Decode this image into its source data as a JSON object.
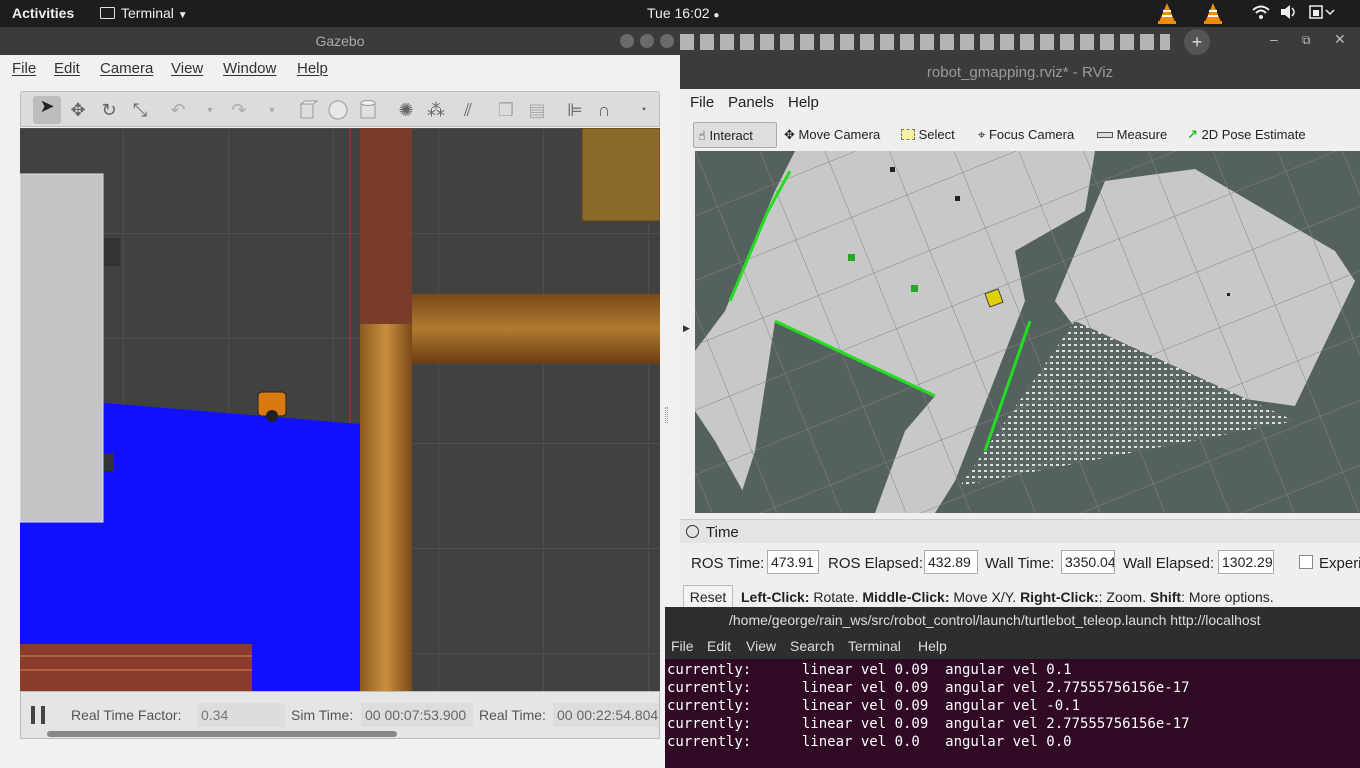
{
  "topbar": {
    "activities": "Activities",
    "app_name": "Terminal",
    "clock": "Tue 16:02"
  },
  "gazebo": {
    "title": "Gazebo",
    "menu": [
      "File",
      "Edit",
      "Camera",
      "View",
      "Window",
      "Help"
    ],
    "status": {
      "rtf_label": "Real Time Factor:",
      "rtf_value": "0.34",
      "sim_label": "Sim Time:",
      "sim_value": "00 00:07:53.900",
      "real_label": "Real Time:",
      "real_value": "00 00:22:54.804"
    }
  },
  "rviz": {
    "title": "robot_gmapping.rviz* - RViz",
    "menu": [
      "File",
      "Panels",
      "Help"
    ],
    "tools": [
      "Interact",
      "Move Camera",
      "Select",
      "Focus Camera",
      "Measure",
      "2D Pose Estimate"
    ],
    "time_panel": {
      "title": "Time",
      "ros_time_label": "ROS Time:",
      "ros_time_value": "473.91",
      "ros_elapsed_label": "ROS Elapsed:",
      "ros_elapsed_value": "432.89",
      "wall_time_label": "Wall Time:",
      "wall_time_value": "3350.04",
      "wall_elapsed_label": "Wall Elapsed:",
      "wall_elapsed_value": "1302.29",
      "experimental_label": "Experi",
      "reset_label": "Reset",
      "hint_bold1": "Left-Click:",
      "hint_text1": " Rotate. ",
      "hint_bold2": "Middle-Click:",
      "hint_text2": " Move X/Y. ",
      "hint_bold3": "Right-Click:",
      "hint_text3": ": Zoom. ",
      "hint_bold4": "Shift",
      "hint_text4": ": More options."
    }
  },
  "terminal": {
    "title": "/home/george/rain_ws/src/robot_control/launch/turtlebot_teleop.launch http://localhost",
    "menu": [
      "File",
      "Edit",
      "View",
      "Search",
      "Terminal",
      "Help"
    ],
    "lines": [
      "currently:      linear vel 0.09  angular vel 0.1",
      "currently:      linear vel 0.09  angular vel 2.77555756156e-17",
      "currently:      linear vel 0.09  angular vel -0.1",
      "currently:      linear vel 0.09  angular vel 2.77555756156e-17",
      "currently:      linear vel 0.0   angular vel 0.0"
    ]
  },
  "colors": {
    "topbar": "#1d1d1d",
    "terminal_bg": "#300a24",
    "ground_blue": "#1010ff",
    "laser_green": "#22dd22"
  }
}
